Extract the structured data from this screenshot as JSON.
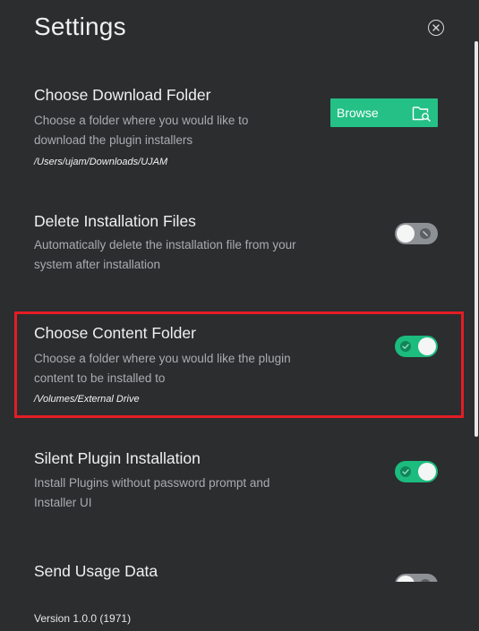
{
  "header": {
    "title": "Settings"
  },
  "settings": {
    "download_folder": {
      "title": "Choose Download Folder",
      "description": "Choose a folder where you would like to download the plugin installers",
      "path": "/Users/ujam/Downloads/UJAM",
      "button_label": "Browse"
    },
    "delete_files": {
      "title": "Delete Installation Files",
      "description": "Automatically delete the installation file from your system after installation",
      "toggle_state": "off"
    },
    "content_folder": {
      "title": "Choose Content Folder",
      "description": "Choose a folder where you would like the plugin content to be installed to",
      "path": "/Volumes/External Drive",
      "toggle_state": "on"
    },
    "silent_install": {
      "title": "Silent Plugin Installation",
      "description": "Install Plugins without password prompt and Installer UI",
      "toggle_state": "on"
    },
    "usage_data": {
      "title": "Send Usage Data",
      "toggle_state": "off"
    }
  },
  "footer": {
    "version": "Version 1.0.0 (1971)"
  },
  "colors": {
    "background": "#2b2d2f",
    "accent_green": "#24c086",
    "toggle_off": "#8d9094",
    "highlight_red": "#e41d24"
  },
  "icons": {
    "close": "close-circle-icon",
    "browse": "folder-search-icon",
    "toggle_on": "check-icon",
    "toggle_off": "block-icon"
  }
}
